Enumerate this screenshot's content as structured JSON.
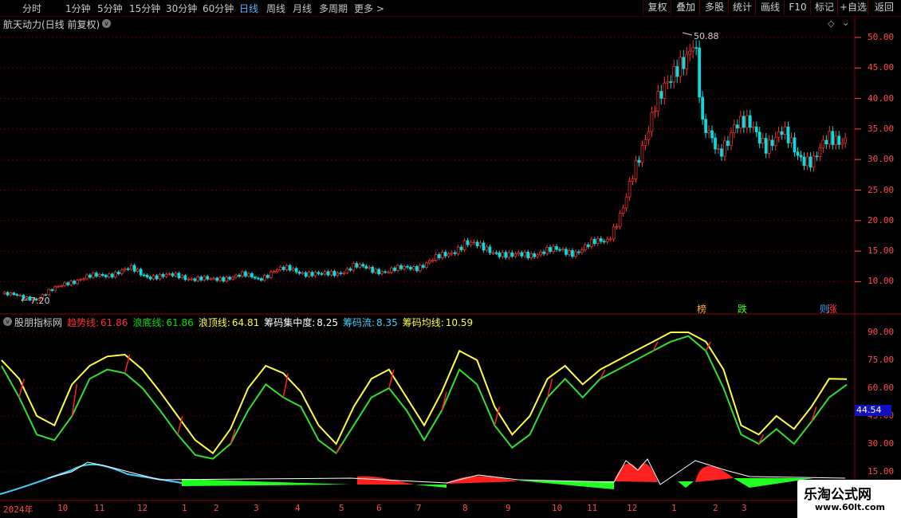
{
  "toolbar": {
    "periods": [
      "分时",
      "1分钟",
      "5分钟",
      "15分钟",
      "30分钟",
      "60分钟",
      "日线",
      "周线",
      "月线",
      "多周期",
      "更多 >"
    ],
    "active_period": "日线",
    "buttons": [
      "复权",
      "叠加",
      "多股",
      "统计",
      "画线",
      "F10",
      "标记",
      "+自选",
      "返回"
    ]
  },
  "main_panel": {
    "title": "航天动力(日线 前复权)",
    "high_label": "50.88",
    "low_label": "7.20",
    "badges": [
      "榜",
      "跌",
      "则",
      "涨"
    ],
    "colors": {
      "up": "#ff3030",
      "down": "#00e0e0",
      "axis": "#ff4a4a",
      "grid": "#5a0000"
    }
  },
  "indicator_panel": {
    "name": "股朋指标网",
    "values": [
      {
        "label": "趋势线:",
        "value": "61.86",
        "color": "#ff3030"
      },
      {
        "label": "浪底线:",
        "value": "61.86",
        "color": "#00e000"
      },
      {
        "label": "浪顶线:",
        "value": "64.81",
        "color": "#ffff40"
      },
      {
        "label": "筹码集中度:",
        "value": "8.25",
        "color": "#ffffff"
      },
      {
        "label": "筹码流:",
        "value": "8.35",
        "color": "#40d0ff"
      },
      {
        "label": "筹码均线:",
        "value": "10.59",
        "color": "#ffff40"
      }
    ],
    "current_value": "44.54"
  },
  "price_axis": [
    "50.00",
    "45.00",
    "40.00",
    "35.00",
    "30.00",
    "25.00",
    "20.00",
    "15.00",
    "10.00"
  ],
  "indicator_axis": [
    "90.00",
    "75.00",
    "60.00",
    "45.00",
    "30.00",
    "15.00"
  ],
  "time_axis": [
    "2024年",
    "10",
    "11",
    "12",
    "1",
    "2",
    "3",
    "4",
    "5",
    "6",
    "7",
    "8",
    "9",
    "10",
    "11",
    "12",
    "1",
    "2",
    "3"
  ],
  "watermark": {
    "line1": "乐淘公式网",
    "line2": "www.60lt.com"
  },
  "chart_data": {
    "type": "line",
    "price_series_approx": {
      "name": "",
      "x": [
        0,
        20,
        40,
        60,
        80,
        100,
        120,
        140,
        160,
        180,
        200,
        220,
        240,
        260,
        280,
        300,
        320,
        340,
        360,
        380,
        400,
        420,
        440,
        460,
        480,
        500,
        520,
        540,
        560,
        580,
        600,
        620,
        640,
        660,
        680,
        700,
        720,
        740,
        760,
        780,
        800,
        820,
        840,
        860,
        870,
        880,
        900,
        920,
        940,
        960,
        980,
        1000,
        1020,
        1040,
        1060
      ],
      "values": [
        8,
        7.5,
        7.2,
        8.5,
        10,
        10.5,
        11,
        11.5,
        12,
        11,
        10.8,
        11,
        10.5,
        10.2,
        10.8,
        11,
        10.5,
        11.8,
        12,
        11.5,
        11,
        11.5,
        12.5,
        12,
        11.8,
        12,
        12.5,
        13.5,
        14.5,
        16.5,
        15.5,
        15,
        14,
        14.5,
        15,
        15,
        15,
        16,
        17,
        22,
        30,
        40,
        42,
        48,
        50.88,
        35,
        31,
        36,
        35,
        33,
        34,
        31,
        30,
        33,
        34,
        36,
        38,
        37,
        35
      ]
    },
    "indicator_series": [
      {
        "name": "浪顶线",
        "values": [
          75,
          65,
          45,
          40,
          62,
          72,
          77,
          78,
          70,
          58,
          45,
          32,
          25,
          38,
          60,
          72,
          68,
          58,
          40,
          30,
          50,
          65,
          70,
          55,
          40,
          58,
          80,
          75,
          50,
          35,
          45,
          65,
          72,
          62,
          70,
          75,
          80,
          85,
          90,
          90,
          85,
          70,
          40,
          35,
          45,
          38,
          50,
          65,
          64.81
        ]
      },
      {
        "name": "浪底线",
        "values": [
          72,
          55,
          35,
          32,
          45,
          65,
          70,
          68,
          60,
          48,
          35,
          24,
          22,
          30,
          48,
          62,
          55,
          50,
          32,
          25,
          40,
          55,
          60,
          48,
          32,
          48,
          70,
          62,
          40,
          28,
          35,
          55,
          65,
          55,
          65,
          70,
          75,
          80,
          85,
          88,
          80,
          60,
          35,
          30,
          38,
          30,
          42,
          55,
          61.86
        ]
      }
    ]
  }
}
